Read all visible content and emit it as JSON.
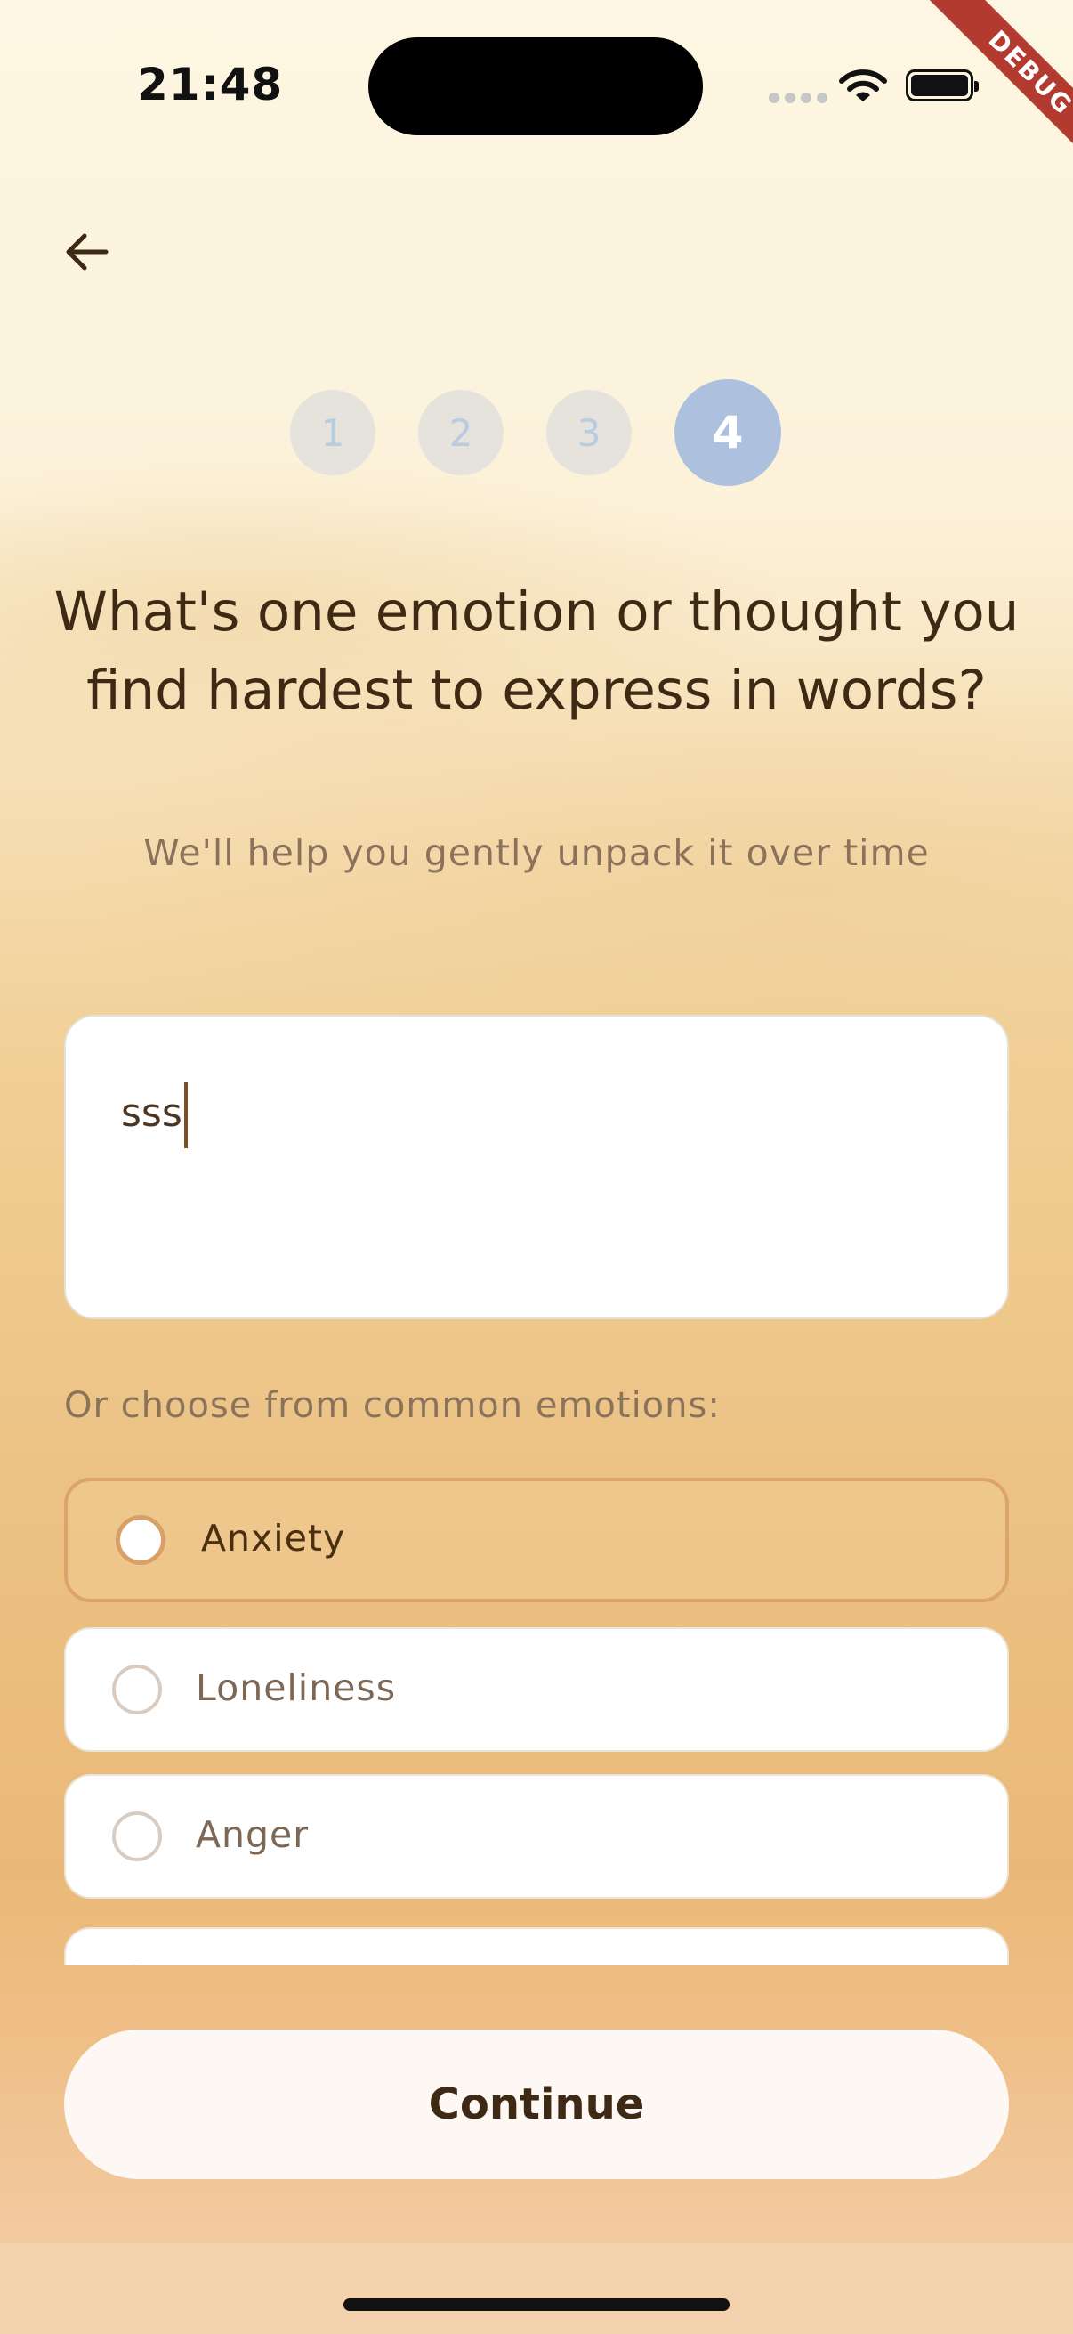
{
  "status_bar": {
    "time": "21:48"
  },
  "debug_banner": "DEBUG",
  "stepper": {
    "steps": [
      "1",
      "2",
      "3",
      "4"
    ],
    "current_step": 4
  },
  "question": {
    "title": "What's one emotion or thought you find hardest to express in words?",
    "subtitle": "We'll help you gently unpack it over time"
  },
  "text_input": {
    "value": "sss"
  },
  "emotions": {
    "label": "Or choose from common emotions:",
    "options": [
      {
        "label": "Anxiety",
        "selected": true
      },
      {
        "label": "Loneliness",
        "selected": false
      },
      {
        "label": "Anger",
        "selected": false
      },
      {
        "label": "",
        "selected": false
      }
    ]
  },
  "continue_label": "Continue",
  "colors": {
    "accent_selected_border": "#dca46a",
    "active_step": "#adc1df",
    "text_dark": "#3e2a14",
    "text_muted": "#8b735b"
  },
  "icons": {
    "back": "arrow-left-icon",
    "wifi": "wifi-icon",
    "battery": "battery-icon",
    "signal": "signal-icon"
  }
}
